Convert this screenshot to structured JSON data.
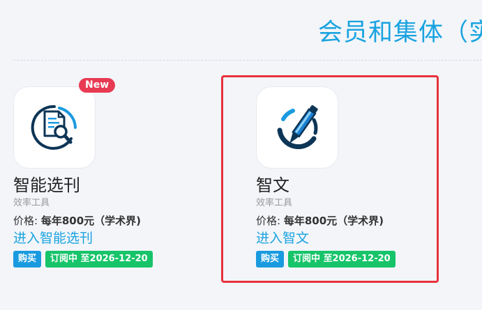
{
  "section": {
    "heading": "会员和集体（实"
  },
  "apps": [
    {
      "badge": "New",
      "name": "智能选刊",
      "category": "效率工具",
      "price_label": "价格: ",
      "price_value": "每年800元（学术界)",
      "enter_link": "进入智能选刊",
      "buy_label": "购买",
      "subscription_label": "订阅中 至2026-12-20",
      "icon": "document-search-icon"
    },
    {
      "name": "智文",
      "category": "效率工具",
      "price_label": "价格: ",
      "price_value": "每年800元（学术界)",
      "enter_link": "进入智文",
      "buy_label": "购买",
      "subscription_label": "订阅中 至2026-12-20",
      "icon": "pen-icon"
    }
  ],
  "colors": {
    "accent": "#1aa3e0",
    "badge": "#e83a52",
    "buy": "#1a9be0",
    "subscribed": "#17c46a",
    "highlight": "#e8323d",
    "icon_dark": "#0d3556"
  }
}
